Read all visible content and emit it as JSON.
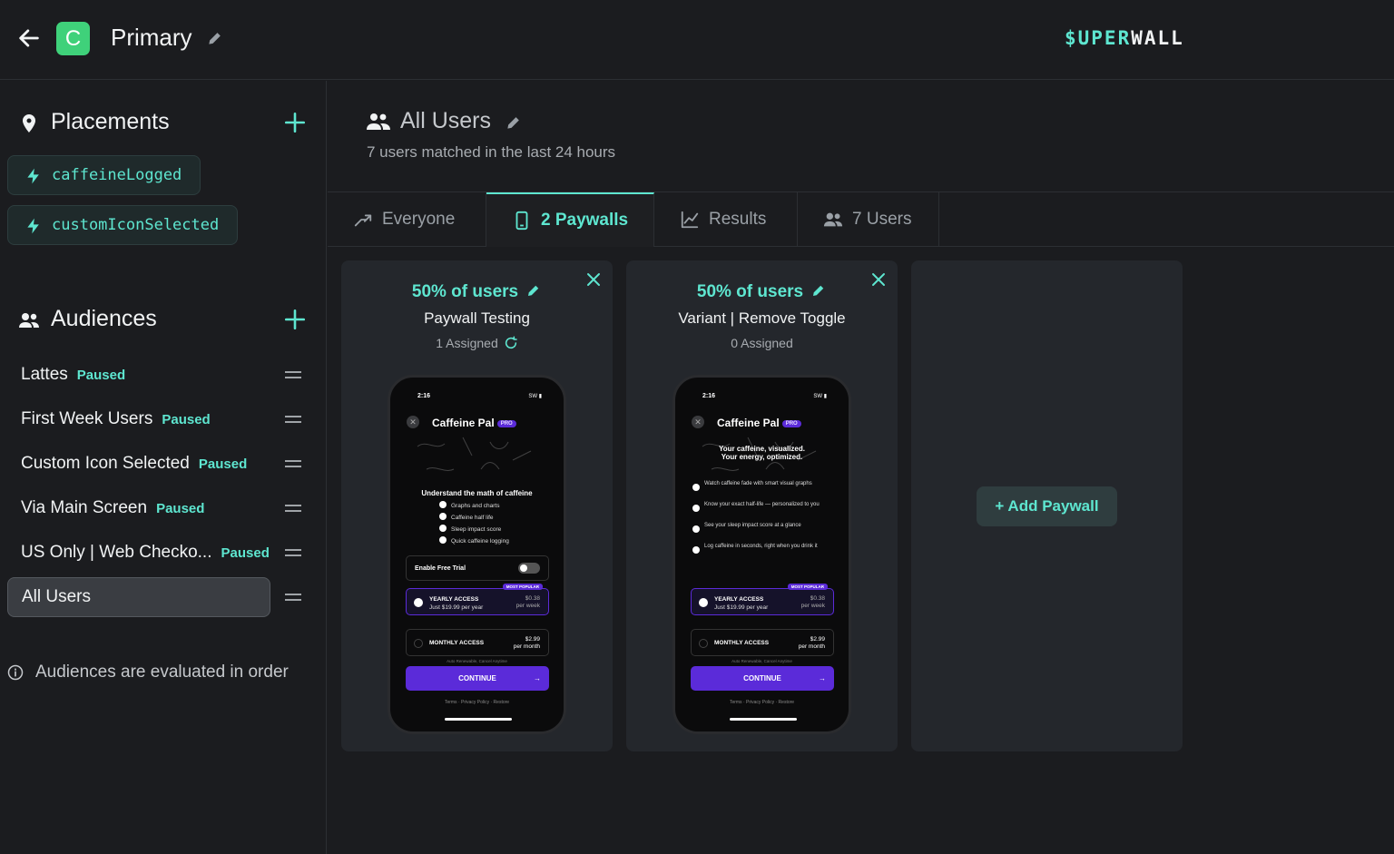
{
  "header": {
    "app_initial": "C",
    "app_name": "Primary",
    "brand_part1": "$UPER",
    "brand_part2": "WALL"
  },
  "sidebar": {
    "placements_title": "Placements",
    "placements": [
      {
        "label": "caffeineLogged"
      },
      {
        "label": "customIconSelected"
      }
    ],
    "audiences_title": "Audiences",
    "audiences": [
      {
        "name": "Lattes",
        "status": "Paused"
      },
      {
        "name": "First Week Users",
        "status": "Paused"
      },
      {
        "name": "Custom Icon Selected",
        "status": "Paused"
      },
      {
        "name": "Via Main Screen",
        "status": "Paused"
      },
      {
        "name": "US Only | Web Checko...",
        "status": "Paused"
      },
      {
        "name": "All Users",
        "status": ""
      }
    ],
    "info_note": "Audiences are evaluated in order"
  },
  "main": {
    "audience_title": "All Users",
    "audience_subtitle": "7 users matched in the last 24 hours",
    "tabs": [
      {
        "label": "Everyone"
      },
      {
        "label": "2 Paywalls"
      },
      {
        "label": "Results"
      },
      {
        "label": "7 Users"
      }
    ],
    "active_tab": "2 Paywalls",
    "paywalls": [
      {
        "percent": "50% of users",
        "name": "Paywall Testing",
        "assigned": "1 Assigned",
        "preview": {
          "time": "2:16",
          "status_right": "SW",
          "app": "Caffeine Pal",
          "pro": "PRO",
          "headline": "Understand the math of caffeine",
          "features": [
            "Graphs and charts",
            "Caffeine half life",
            "Sleep impact score",
            "Quick caffeine logging"
          ],
          "toggle_label": "Enable Free Trial",
          "yearly_name": "YEARLY ACCESS",
          "yearly_sub": "Just $19.99 per year",
          "yearly_price": "$0.38",
          "yearly_unit": "per week",
          "popular": "MOST POPULAR",
          "monthly_name": "MONTHLY ACCESS",
          "monthly_price": "$2.99",
          "monthly_unit": "per month",
          "renew": "Auto Renewable, Cancel Anytime",
          "cta": "CONTINUE",
          "footer": "Terms  ·  Privacy Policy  ·  Restore"
        }
      },
      {
        "percent": "50% of users",
        "name": "Variant | Remove Toggle",
        "assigned": "0 Assigned",
        "preview": {
          "time": "2:16",
          "status_right": "SW",
          "app": "Caffeine Pal",
          "pro": "PRO",
          "headline_line1": "Your caffeine, visualized.",
          "headline_line2": "Your energy, optimized.",
          "features": [
            "Watch caffeine fade with smart visual graphs",
            "Know your exact half-life — personalized to you",
            "See your sleep impact score at a glance",
            "Log caffeine in seconds, right when you drink it"
          ],
          "yearly_name": "YEARLY ACCESS",
          "yearly_sub": "Just $19.99 per year",
          "yearly_price": "$0.38",
          "yearly_unit": "per week",
          "popular": "MOST POPULAR",
          "monthly_name": "MONTHLY ACCESS",
          "monthly_price": "$2.99",
          "monthly_unit": "per month",
          "renew": "Auto Renewable, Cancel Anytime",
          "cta": "CONTINUE",
          "footer": "Terms  ·  Privacy Policy  ·  Restore"
        }
      }
    ],
    "add_paywall_label": "+ Add Paywall"
  },
  "colors": {
    "accent": "#5ee6d0",
    "app_badge": "#3fd17a",
    "purple": "#5b2bd9",
    "background": "#1b1c1f",
    "card": "#24272c"
  },
  "icons": [
    "back-arrow-icon",
    "pencil-icon",
    "map-pin-icon",
    "plus-icon",
    "bolt-icon",
    "users-icon",
    "drag-handle-icon",
    "info-icon",
    "split-icon",
    "phone-icon",
    "chart-icon",
    "close-icon",
    "refresh-icon"
  ]
}
